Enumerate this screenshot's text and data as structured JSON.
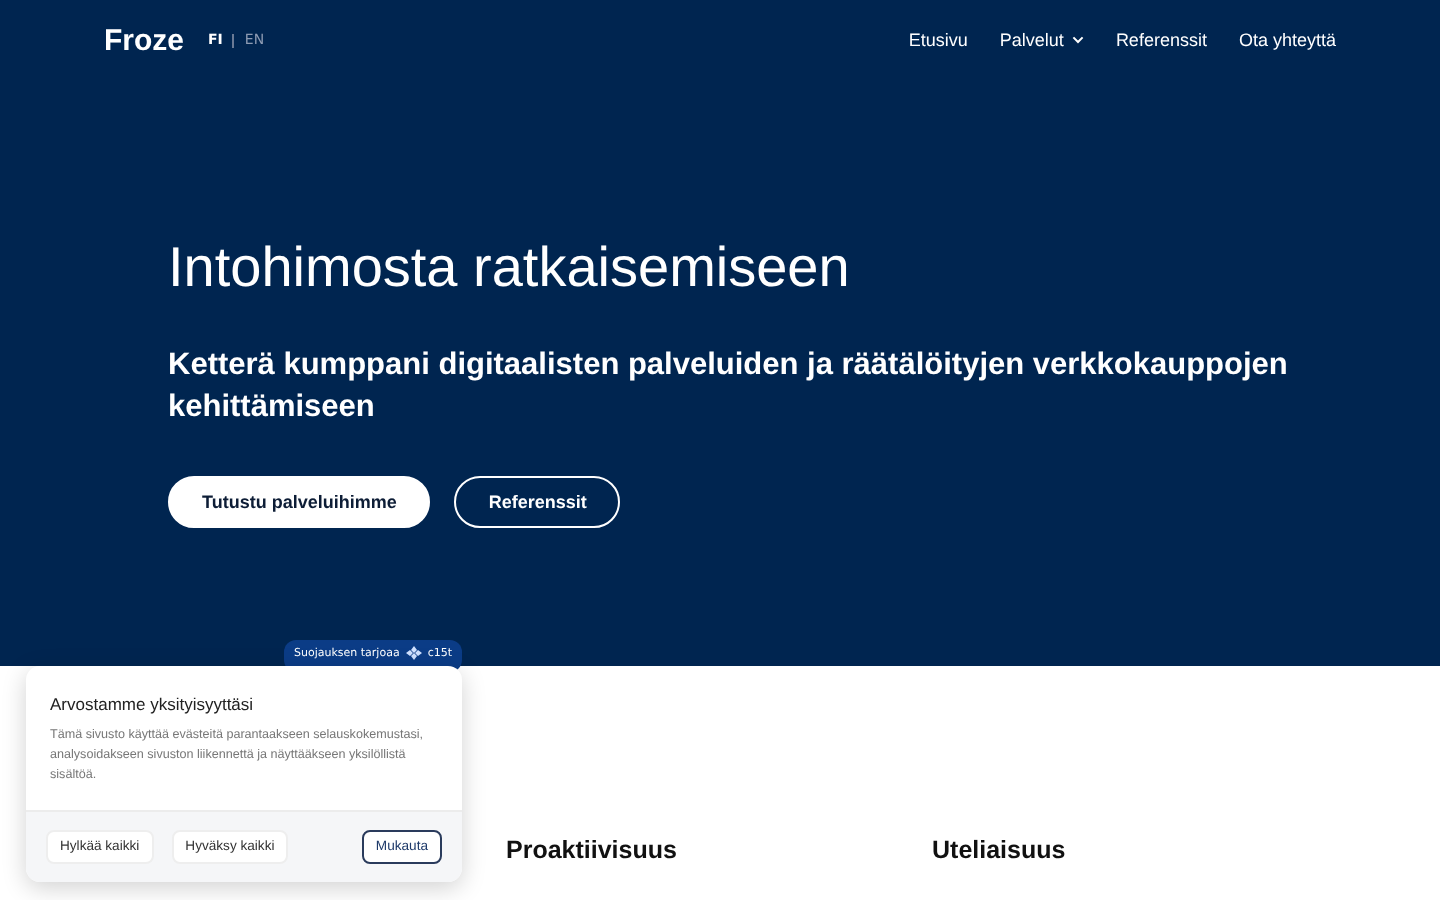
{
  "header": {
    "logo": "Froze",
    "languages": [
      {
        "label": "FI",
        "selected": true
      },
      {
        "label": "EN",
        "selected": false
      }
    ],
    "nav": [
      {
        "label": "Etusivu",
        "dropdown": false
      },
      {
        "label": "Palvelut",
        "dropdown": true
      },
      {
        "label": "Referenssit",
        "dropdown": false
      },
      {
        "label": "Ota yhteyttä",
        "dropdown": false
      }
    ]
  },
  "hero": {
    "title": "Intohimosta ratkaisemiseen",
    "subtitle": "Ketterä kumppani digitaalisten palveluiden ja räätälöityjen verkkokauppojen kehittämiseen",
    "buttons": [
      {
        "label": "Tutustu palveluihimme",
        "kind": "primary"
      },
      {
        "label": "Referenssit",
        "kind": "outline"
      }
    ]
  },
  "values": [
    "Proaktiivisuus",
    "Uteliaisuus"
  ],
  "cookie_banner": {
    "provider_badge": "Suojauksen tarjoaa",
    "provider_name": "c15t",
    "title": "Arvostamme yksityisyyttäsi",
    "text": "Tämä sivusto käyttää evästeitä parantaakseen selauskokemustasi, analysoidakseen sivuston liikennettä ja näyttääkseen yksilöllistä sisältöä.",
    "buttons": [
      {
        "label": "Hylkää kaikki",
        "kind": "plain"
      },
      {
        "label": "Hyväksy kaikki",
        "kind": "plain"
      },
      {
        "label": "Mukauta",
        "kind": "outline"
      }
    ]
  }
}
